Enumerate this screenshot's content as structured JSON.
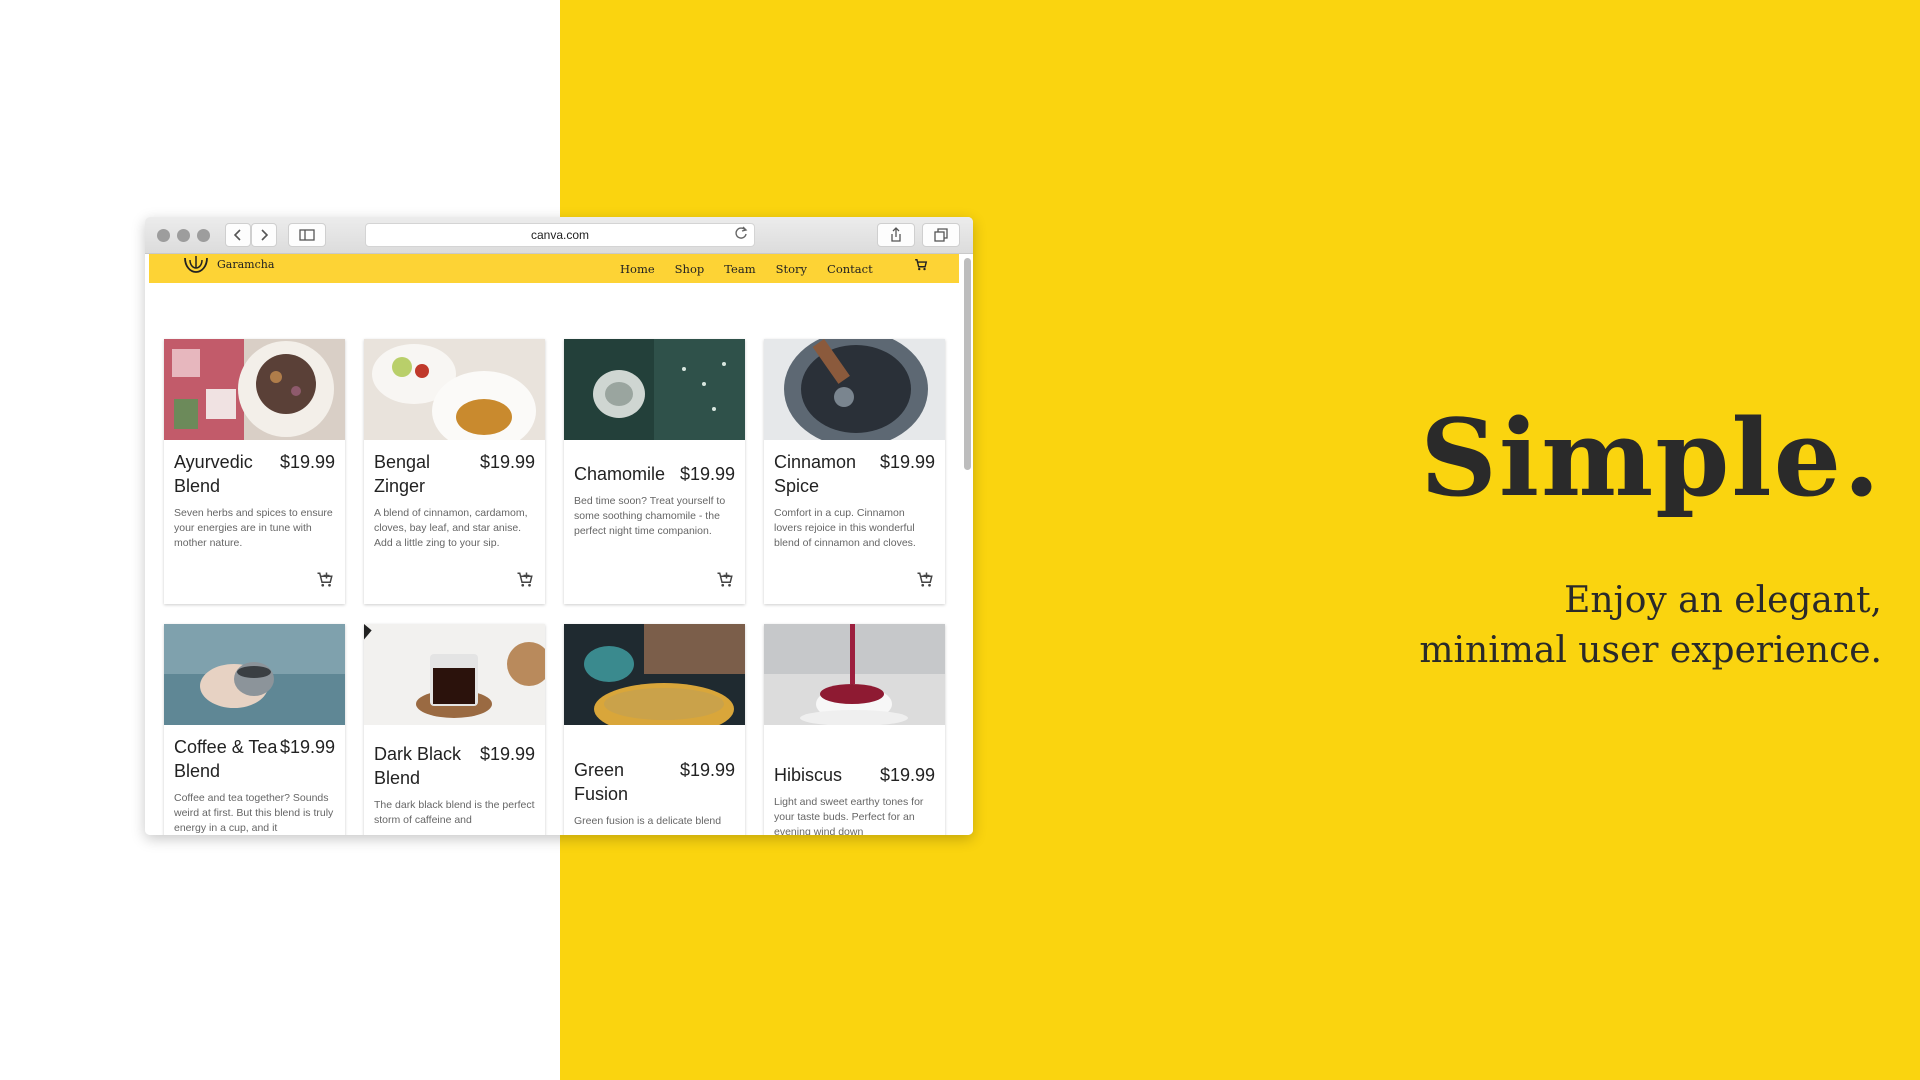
{
  "hero": {
    "title": "Simple.",
    "subtitle_line1": "Enjoy an elegant,",
    "subtitle_line2": "minimal user experience."
  },
  "browser": {
    "url": "canva.com",
    "buttons": [
      "back-icon",
      "forward-icon",
      "sidebar-icon",
      "reload-icon",
      "share-icon",
      "tabs-icon"
    ]
  },
  "site": {
    "brand": "Garamcha",
    "nav": [
      "Home",
      "Shop",
      "Team",
      "Story",
      "Contact"
    ],
    "nav_color": "#fdd335"
  },
  "products": [
    {
      "name": "Ayurvedic Blend",
      "price": "$19.99",
      "desc": "Seven herbs and spices to ensure your energies are in tune with mother nature."
    },
    {
      "name": "Bengal Zinger",
      "price": "$19.99",
      "desc": "A blend of cinnamon, cardamom, cloves, bay leaf, and star anise. Add a little zing to your sip."
    },
    {
      "name": "Chamomile",
      "price": "$19.99",
      "desc": "Bed time soon? Treat yourself to some soothing chamomile - the perfect night time companion."
    },
    {
      "name": "Cinnamon Spice",
      "price": "$19.99",
      "desc": "Comfort in a cup. Cinnamon lovers rejoice in this wonderful blend of cinnamon and cloves."
    },
    {
      "name": "Coffee & Tea Blend",
      "price": "$19.99",
      "desc": "Coffee and tea together? Sounds weird at first. But this blend is truly energy in a cup, and it"
    },
    {
      "name": "Dark Black Blend",
      "price": "$19.99",
      "desc": "The dark black blend is the perfect storm of caffeine and"
    },
    {
      "name": "Green Fusion",
      "price": "$19.99",
      "desc": "Green fusion is a delicate blend"
    },
    {
      "name": "Hibiscus",
      "price": "$19.99",
      "desc": "Light and sweet earthy tones for your taste buds. Perfect for an evening wind down"
    }
  ],
  "colors": {
    "accent": "#fad40f",
    "text": "#2a2a2a"
  }
}
